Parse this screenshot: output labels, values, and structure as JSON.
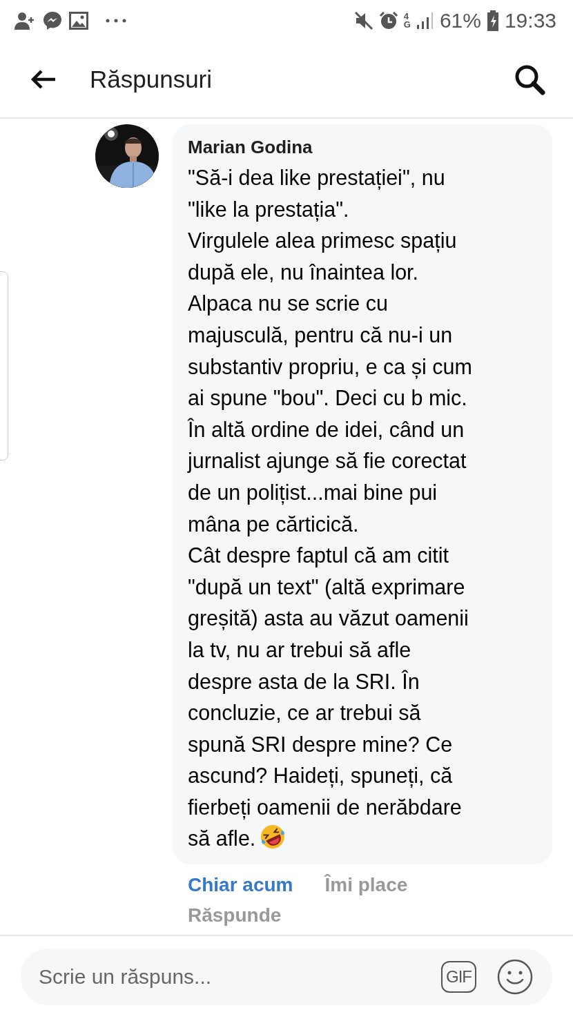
{
  "status_bar": {
    "network": "4G",
    "battery": "61%",
    "time": "19:33"
  },
  "header": {
    "title": "Răspunsuri"
  },
  "comment": {
    "author": "Marian Godina",
    "lines": [
      "\"Să-i dea like prestației\", nu",
      "\"like la prestația\".",
      "Virgulele alea primesc spațiu",
      "după ele, nu înaintea lor.",
      "Alpaca nu se scrie cu",
      "majusculă, pentru că nu-i un",
      "substantiv propriu, e ca și cum",
      "ai spune \"bou\". Deci cu b mic.",
      "În altă ordine de idei, când un",
      "jurnalist ajunge să fie corectat",
      "de un polițist...mai bine pui",
      "mâna pe cărticică.",
      "Cât despre faptul că am citit",
      "\"după un text\" (altă exprimare",
      "greșită) asta au văzut oamenii",
      "la tv, nu ar trebui să afle",
      "despre asta de la SRI. În",
      "concluzie, ce ar trebui să",
      "spună SRI despre mine? Ce",
      "ascund? Haideți, spuneți, că",
      "fierbeți oamenii de nerăbdare",
      "să afle."
    ],
    "time": "Chiar acum",
    "actions": [
      "Îmi place",
      "Răspunde"
    ]
  },
  "composer": {
    "placeholder": "Scrie un răspuns...",
    "gif": "GIF"
  }
}
